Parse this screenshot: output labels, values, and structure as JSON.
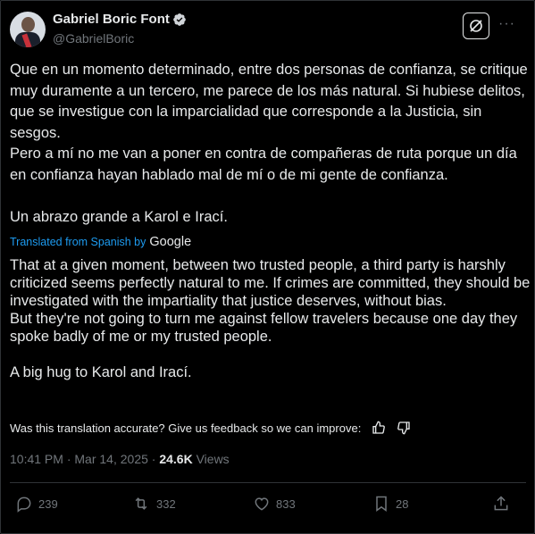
{
  "author": {
    "name": "Gabriel Boric Font",
    "handle": "@GabrielBoric"
  },
  "tweet": {
    "original_paragraphs": [
      "Que en un momento determinado, entre dos personas de confianza, se critique muy duramente a un tercero, me parece de los más natural. Si hubiese delitos, que se investigue con la imparcialidad que corresponde a la Justicia, sin sesgos.",
      "Pero a mí no me van a poner en contra de compañeras de ruta porque un día en confianza hayan hablado mal de mí o de mi gente de confianza.",
      "Un abrazo grande a Karol e Irací."
    ],
    "translated_from_label": "Translated from Spanish by",
    "translator_brand": "Google",
    "translated_paragraphs": [
      "That at a given moment, between two trusted people, a third party is harshly criticized seems perfectly natural to me. If crimes are committed, they should be investigated with the impartiality that justice deserves, without bias.",
      "But they're not going to turn me against fellow travelers because one day they spoke badly of me or my trusted people.",
      "A big hug to Karol and Irací."
    ],
    "feedback_prompt": "Was this translation accurate? Give us feedback so we can improve:",
    "time": "10:41 PM",
    "date": "Mar 14, 2025",
    "views_count": "24.6K",
    "views_label": "Views"
  },
  "actions": {
    "replies": "239",
    "reposts": "332",
    "likes": "833",
    "bookmarks": "28"
  },
  "colors": {
    "background": "#000000",
    "text": "#e7e9ea",
    "muted": "#71767b",
    "accent": "#1d9bf0",
    "border": "#2f3336"
  },
  "icons": [
    "verified-badge-icon",
    "grok-icon",
    "more-icon",
    "thumbs-up-icon",
    "thumbs-down-icon",
    "reply-icon",
    "repost-icon",
    "like-icon",
    "bookmark-icon",
    "share-icon"
  ]
}
